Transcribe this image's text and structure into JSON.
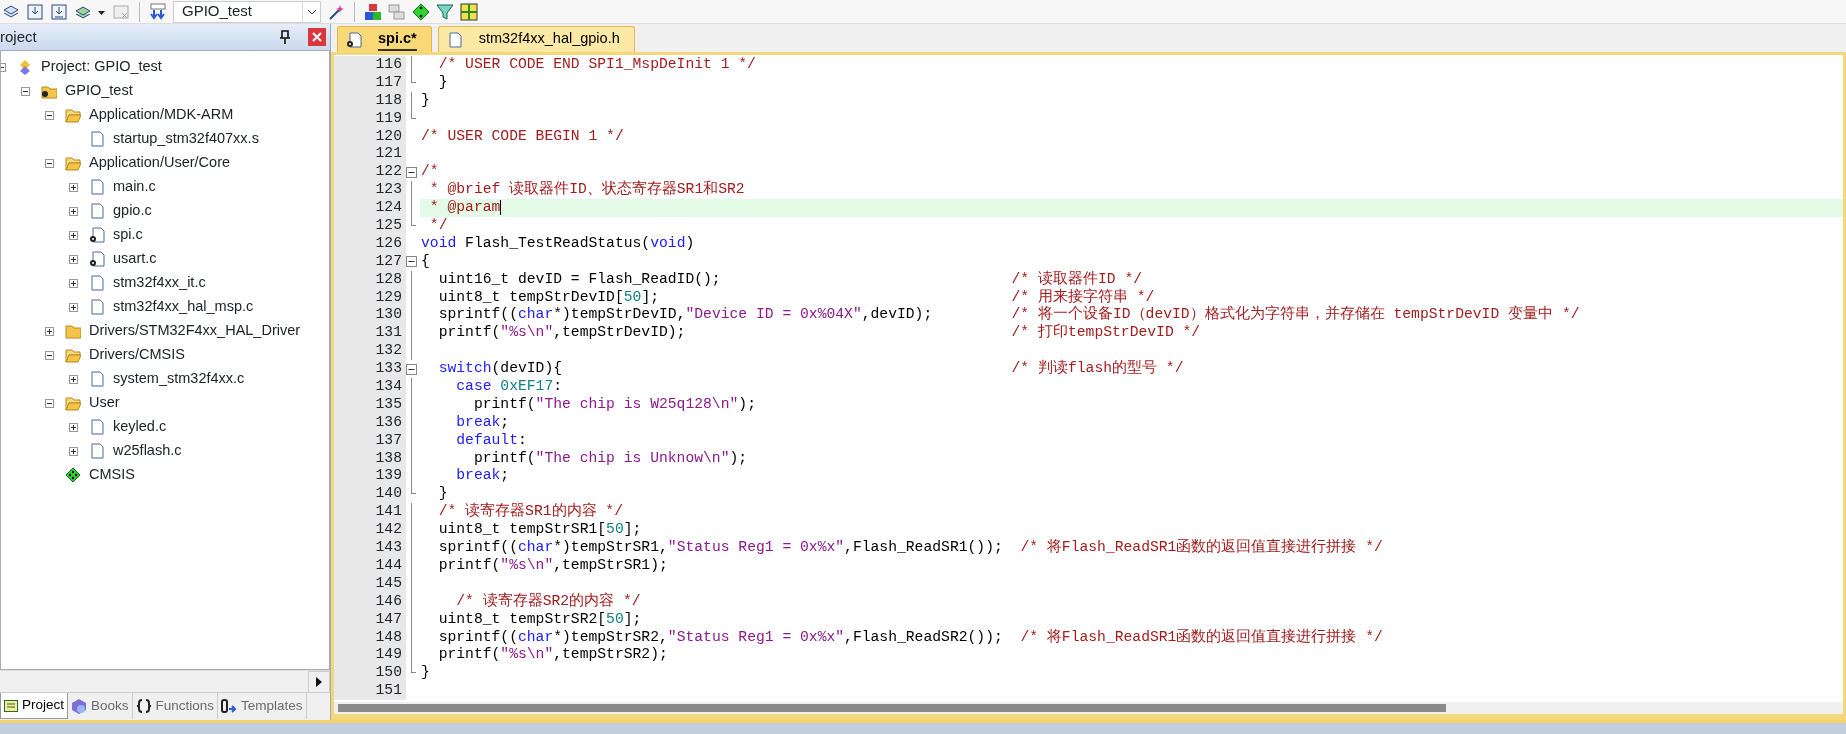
{
  "toolbar": {
    "target": "GPIO_test"
  },
  "project_panel": {
    "title": "roject",
    "tree": [
      {
        "label": "Project: GPIO_test",
        "kind": "project",
        "expanded": true,
        "children": [
          {
            "label": "GPIO_test",
            "kind": "target",
            "expanded": true,
            "children": [
              {
                "label": "Application/MDK-ARM",
                "kind": "folder",
                "expanded": true,
                "children": [
                  {
                    "label": "startup_stm32f407xx.s",
                    "kind": "file"
                  }
                ]
              },
              {
                "label": "Application/User/Core",
                "kind": "folder",
                "expanded": true,
                "children": [
                  {
                    "label": "main.c",
                    "kind": "file",
                    "expanded": false
                  },
                  {
                    "label": "gpio.c",
                    "kind": "file",
                    "expanded": false
                  },
                  {
                    "label": "spi.c",
                    "kind": "config-file",
                    "expanded": false
                  },
                  {
                    "label": "usart.c",
                    "kind": "config-file",
                    "expanded": false
                  },
                  {
                    "label": "stm32f4xx_it.c",
                    "kind": "file",
                    "expanded": false
                  },
                  {
                    "label": "stm32f4xx_hal_msp.c",
                    "kind": "file",
                    "expanded": false
                  }
                ]
              },
              {
                "label": "Drivers/STM32F4xx_HAL_Driver",
                "kind": "closed-folder",
                "expanded": false
              },
              {
                "label": "Drivers/CMSIS",
                "kind": "folder",
                "expanded": true,
                "children": [
                  {
                    "label": "system_stm32f4xx.c",
                    "kind": "file",
                    "expanded": false
                  }
                ]
              },
              {
                "label": "User",
                "kind": "folder",
                "expanded": true,
                "children": [
                  {
                    "label": "keyled.c",
                    "kind": "file",
                    "expanded": false
                  },
                  {
                    "label": "w25flash.c",
                    "kind": "file",
                    "expanded": false
                  }
                ]
              },
              {
                "label": "CMSIS",
                "kind": "component"
              }
            ]
          }
        ]
      }
    ],
    "bottom_tabs": [
      {
        "label": "Project",
        "kind": "project",
        "selected": true
      },
      {
        "label": "Books",
        "kind": "books",
        "selected": false
      },
      {
        "label": "Functions",
        "kind": "functions",
        "selected": false
      },
      {
        "label": "Templates",
        "kind": "templates",
        "selected": false
      }
    ]
  },
  "editor": {
    "tabs": [
      {
        "label": "spi.c*",
        "kind": "config-file",
        "selected": true
      },
      {
        "label": "stm32f4xx_hal_gpio.h",
        "kind": "file",
        "selected": false
      }
    ],
    "lines": [
      {
        "number": "116",
        "kind": "line",
        "current": false,
        "tokens": [
          {
            "kind": "comment",
            "text": "  /* USER CODE END SPI1_MspDeInit 1 */"
          }
        ]
      },
      {
        "number": "117",
        "kind": "end",
        "current": false,
        "tokens": [
          {
            "kind": "plain",
            "text": "  }"
          }
        ]
      },
      {
        "number": "118",
        "kind": "line",
        "current": false,
        "tokens": [
          {
            "kind": "plain",
            "text": "}"
          }
        ]
      },
      {
        "number": "119",
        "kind": "end",
        "current": false
      },
      {
        "number": "120",
        "kind": "none",
        "current": false,
        "tokens": [
          {
            "kind": "comment",
            "text": "/* USER CODE BEGIN 1 */"
          }
        ]
      },
      {
        "number": "121",
        "kind": "none",
        "current": false
      },
      {
        "number": "122",
        "kind": "open",
        "current": false,
        "tokens": [
          {
            "kind": "comment",
            "text": "/*"
          }
        ]
      },
      {
        "number": "123",
        "kind": "line",
        "current": false,
        "tokens": [
          {
            "kind": "comment",
            "text": " * @brief 读取器件ID、状态寄存器SR1和SR2"
          }
        ]
      },
      {
        "number": "124",
        "kind": "line",
        "current": true,
        "tokens": [
          {
            "kind": "comment",
            "text": " * @param"
          }
        ]
      },
      {
        "number": "125",
        "kind": "end",
        "current": false,
        "tokens": [
          {
            "kind": "comment",
            "text": " */"
          }
        ]
      },
      {
        "number": "126",
        "kind": "none",
        "current": false,
        "tokens": [
          {
            "kind": "keyword",
            "text": "void"
          },
          {
            "kind": "plain",
            "text": " Flash_TestReadStatus("
          },
          {
            "kind": "keyword",
            "text": "void"
          },
          {
            "kind": "plain",
            "text": ")"
          }
        ]
      },
      {
        "number": "127",
        "kind": "open",
        "current": false,
        "tokens": [
          {
            "kind": "plain",
            "text": "{"
          }
        ]
      },
      {
        "number": "128",
        "kind": "line",
        "current": false,
        "tokens": [
          {
            "kind": "plain",
            "text": "  uint16_t devID = Flash_ReadID();"
          }
        ],
        "note": "/* 读取器件ID */"
      },
      {
        "number": "129",
        "kind": "line",
        "current": false,
        "tokens": [
          {
            "kind": "plain",
            "text": "  uint8_t tempStrDevID["
          },
          {
            "kind": "number",
            "text": "50"
          },
          {
            "kind": "plain",
            "text": "];"
          }
        ],
        "note": "/* 用来接字符串 */"
      },
      {
        "number": "130",
        "kind": "line",
        "current": false,
        "tokens": [
          {
            "kind": "plain",
            "text": "  sprintf(("
          },
          {
            "kind": "keyword",
            "text": "char"
          },
          {
            "kind": "plain",
            "text": "*)tempStrDevID,"
          },
          {
            "kind": "string",
            "text": "\"Device ID = 0x%04X\""
          },
          {
            "kind": "plain",
            "text": ",devID);"
          }
        ],
        "note": "/* 将一个设备ID（devID）格式化为字符串，并存储在 tempStrDevID 变量中 */"
      },
      {
        "number": "131",
        "kind": "line",
        "current": false,
        "tokens": [
          {
            "kind": "plain",
            "text": "  printf("
          },
          {
            "kind": "string",
            "text": "\"%s\\n\""
          },
          {
            "kind": "plain",
            "text": ",tempStrDevID);"
          }
        ],
        "note": "/* 打印tempStrDevID */"
      },
      {
        "number": "132",
        "kind": "line",
        "current": false
      },
      {
        "number": "133",
        "kind": "open",
        "current": false,
        "tokens": [
          {
            "kind": "keyword",
            "text": "  switch"
          },
          {
            "kind": "plain",
            "text": "(devID){"
          }
        ],
        "note": "/* 判读flash的型号 */"
      },
      {
        "number": "134",
        "kind": "line",
        "current": false,
        "tokens": [
          {
            "kind": "keyword",
            "text": "    case"
          },
          {
            "kind": "number",
            "text": " 0xEF17"
          },
          {
            "kind": "plain",
            "text": ":"
          }
        ]
      },
      {
        "number": "135",
        "kind": "line",
        "current": false,
        "tokens": [
          {
            "kind": "plain",
            "text": "      printf("
          },
          {
            "kind": "string",
            "text": "\"The chip is W25q128\\n\""
          },
          {
            "kind": "plain",
            "text": ");"
          }
        ]
      },
      {
        "number": "136",
        "kind": "line",
        "current": false,
        "tokens": [
          {
            "kind": "keyword",
            "text": "    break"
          },
          {
            "kind": "plain",
            "text": ";"
          }
        ]
      },
      {
        "number": "137",
        "kind": "line",
        "current": false,
        "tokens": [
          {
            "kind": "keyword",
            "text": "    default"
          },
          {
            "kind": "plain",
            "text": ":"
          }
        ]
      },
      {
        "number": "138",
        "kind": "line",
        "current": false,
        "tokens": [
          {
            "kind": "plain",
            "text": "      printf("
          },
          {
            "kind": "string",
            "text": "\"The chip is Unknow\\n\""
          },
          {
            "kind": "plain",
            "text": ");"
          }
        ]
      },
      {
        "number": "139",
        "kind": "line",
        "current": false,
        "tokens": [
          {
            "kind": "keyword",
            "text": "    break"
          },
          {
            "kind": "plain",
            "text": ";"
          }
        ]
      },
      {
        "number": "140",
        "kind": "end",
        "current": false,
        "tokens": [
          {
            "kind": "plain",
            "text": "  }"
          }
        ]
      },
      {
        "number": "141",
        "kind": "line",
        "current": false,
        "tokens": [
          {
            "kind": "comment",
            "text": "  /* 读寄存器SR1的内容 */"
          }
        ]
      },
      {
        "number": "142",
        "kind": "line",
        "current": false,
        "tokens": [
          {
            "kind": "plain",
            "text": "  uint8_t tempStrSR1["
          },
          {
            "kind": "number",
            "text": "50"
          },
          {
            "kind": "plain",
            "text": "];"
          }
        ]
      },
      {
        "number": "143",
        "kind": "line",
        "current": false,
        "tokens": [
          {
            "kind": "plain",
            "text": "  sprintf(("
          },
          {
            "kind": "keyword",
            "text": "char"
          },
          {
            "kind": "plain",
            "text": "*)tempStrSR1,"
          },
          {
            "kind": "string",
            "text": "\"Status Reg1 = 0x%x\""
          },
          {
            "kind": "plain",
            "text": ",Flash_ReadSR1());"
          },
          {
            "kind": "comment",
            "text": "  /* 将Flash_ReadSR1函数的返回值直接进行拼接 */"
          }
        ]
      },
      {
        "number": "144",
        "kind": "line",
        "current": false,
        "tokens": [
          {
            "kind": "plain",
            "text": "  printf("
          },
          {
            "kind": "string",
            "text": "\"%s\\n\""
          },
          {
            "kind": "plain",
            "text": ",tempStrSR1);"
          }
        ]
      },
      {
        "number": "145",
        "kind": "line",
        "current": false
      },
      {
        "number": "146",
        "kind": "line",
        "current": false,
        "tokens": [
          {
            "kind": "comment",
            "text": "    /* 读寄存器SR2的内容 */"
          }
        ]
      },
      {
        "number": "147",
        "kind": "line",
        "current": false,
        "tokens": [
          {
            "kind": "plain",
            "text": "  uint8_t tempStrSR2["
          },
          {
            "kind": "number",
            "text": "50"
          },
          {
            "kind": "plain",
            "text": "];"
          }
        ]
      },
      {
        "number": "148",
        "kind": "line",
        "current": false,
        "tokens": [
          {
            "kind": "plain",
            "text": "  sprintf(("
          },
          {
            "kind": "keyword",
            "text": "char"
          },
          {
            "kind": "plain",
            "text": "*)tempStrSR2,"
          },
          {
            "kind": "string",
            "text": "\"Status Reg1 = 0x%x\""
          },
          {
            "kind": "plain",
            "text": ",Flash_ReadSR2());"
          },
          {
            "kind": "comment",
            "text": "  /* 将Flash_ReadSR1函数的返回值直接进行拼接 */"
          }
        ]
      },
      {
        "number": "149",
        "kind": "line",
        "current": false,
        "tokens": [
          {
            "kind": "plain",
            "text": "  printf("
          },
          {
            "kind": "string",
            "text": "\"%s\\n\""
          },
          {
            "kind": "plain",
            "text": ",tempStrSR2);"
          }
        ]
      },
      {
        "number": "150",
        "kind": "end",
        "current": false,
        "tokens": [
          {
            "kind": "plain",
            "text": "}"
          }
        ]
      },
      {
        "number": "151",
        "kind": "none",
        "current": false
      }
    ]
  }
}
